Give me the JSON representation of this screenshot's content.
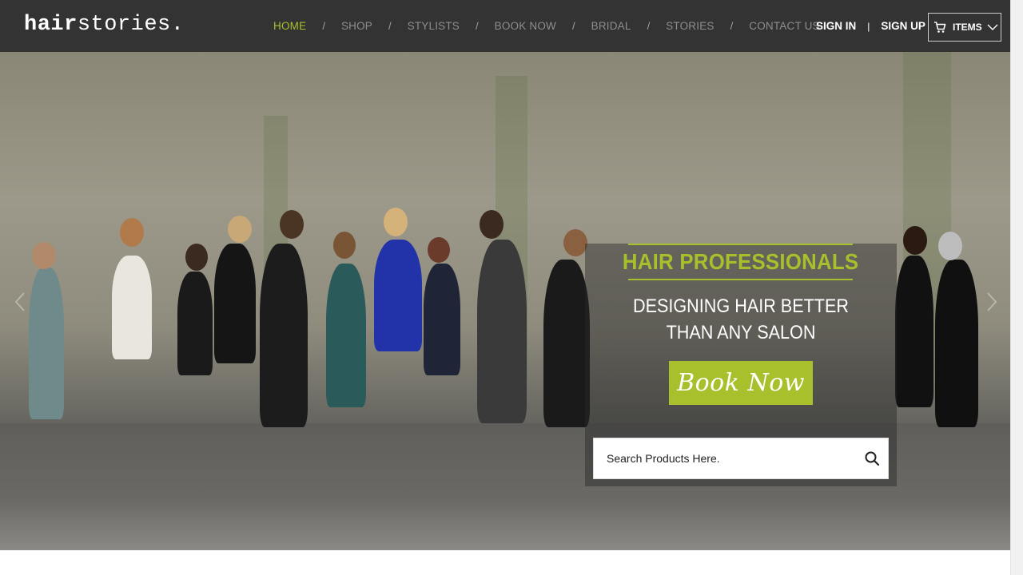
{
  "brand": {
    "logo_bold": "hair",
    "logo_light": "stories."
  },
  "nav": {
    "items": [
      {
        "label": "HOME",
        "active": true
      },
      {
        "label": "SHOP"
      },
      {
        "label": "STYLISTS"
      },
      {
        "label": "BOOK NOW"
      },
      {
        "label": "BRIDAL"
      },
      {
        "label": "STORIES"
      },
      {
        "label": "CONTACT US"
      }
    ],
    "separator": "/"
  },
  "auth": {
    "sign_in": "SIGN IN",
    "divider": "|",
    "sign_up": "SIGN UP"
  },
  "cart": {
    "label": "ITEMS",
    "icon": "cart-icon",
    "chevron": "chevron-down-icon"
  },
  "hero": {
    "headline": "HAIR PROFESSIONALS",
    "subline_1": "DESIGNING HAIR BETTER",
    "subline_2": "THAN ANY SALON",
    "cta": "Book Now",
    "search_placeholder": "Search Products Here."
  },
  "colors": {
    "accent": "#a7c02c",
    "header_bg": "#333333",
    "nav_text": "#8e8e8e",
    "white": "#ffffff"
  }
}
